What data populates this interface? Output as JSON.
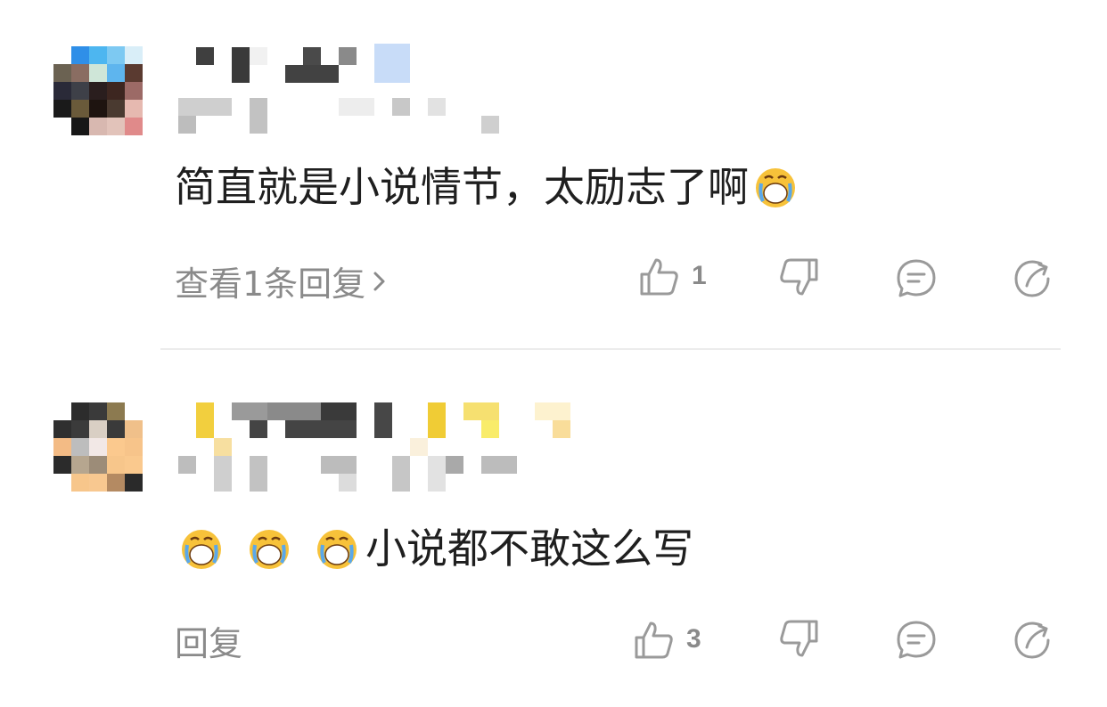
{
  "comments": [
    {
      "text": "简直就是小说情节，太励志了啊",
      "text_emojis_after": [
        "crying-face"
      ],
      "reply_action": "查看1条回复",
      "like_count": "1",
      "avatar_colors": [
        [
          "#ffffff",
          "#2f8fe8",
          "#4db6f0",
          "#7dc9f2",
          "#d9eef8"
        ],
        [
          "#6b6252",
          "#8a6d62",
          "#cfe6d8",
          "#5eb5ee",
          "#5a3a30"
        ],
        [
          "#2a2a38",
          "#3e4048",
          "#2a1e1e",
          "#3d2620",
          "#9c6a66"
        ],
        [
          "#1a1a1a",
          "#6a5a3a",
          "#1e1410",
          "#4a3a30",
          "#e6b9b0"
        ],
        [
          "#ffffff",
          "#171717",
          "#d8b8b0",
          "#e2c3ba",
          "#e08a8a"
        ]
      ]
    },
    {
      "text": "小说都不敢这么写",
      "text_emojis_before": [
        "crying-face",
        "crying-face",
        "crying-face"
      ],
      "reply_action": "回复",
      "like_count": "3",
      "avatar_colors": [
        [
          "#ffffff",
          "#2c2c2c",
          "#3a3a3a",
          "#8c7a50",
          "#ffffff"
        ],
        [
          "#2f2f2f",
          "#3b3b3b",
          "#d9cfc4",
          "#3a3a3a",
          "#f0c08a"
        ],
        [
          "#f3bb85",
          "#bdbdbd",
          "#f2e8e6",
          "#fbc98e",
          "#f7c48a"
        ],
        [
          "#2b2b2b",
          "#b6a68f",
          "#9c8c78",
          "#f7c68b",
          "#fac98e"
        ],
        [
          "#ffffff",
          "#f7c68b",
          "#f8c890",
          "#b48a62",
          "#2a2a2a"
        ]
      ]
    }
  ],
  "colors": {
    "text": "#1f1f1f",
    "secondary": "#8a8a8a",
    "icon": "#9a9a9a",
    "divider": "#ececec"
  }
}
